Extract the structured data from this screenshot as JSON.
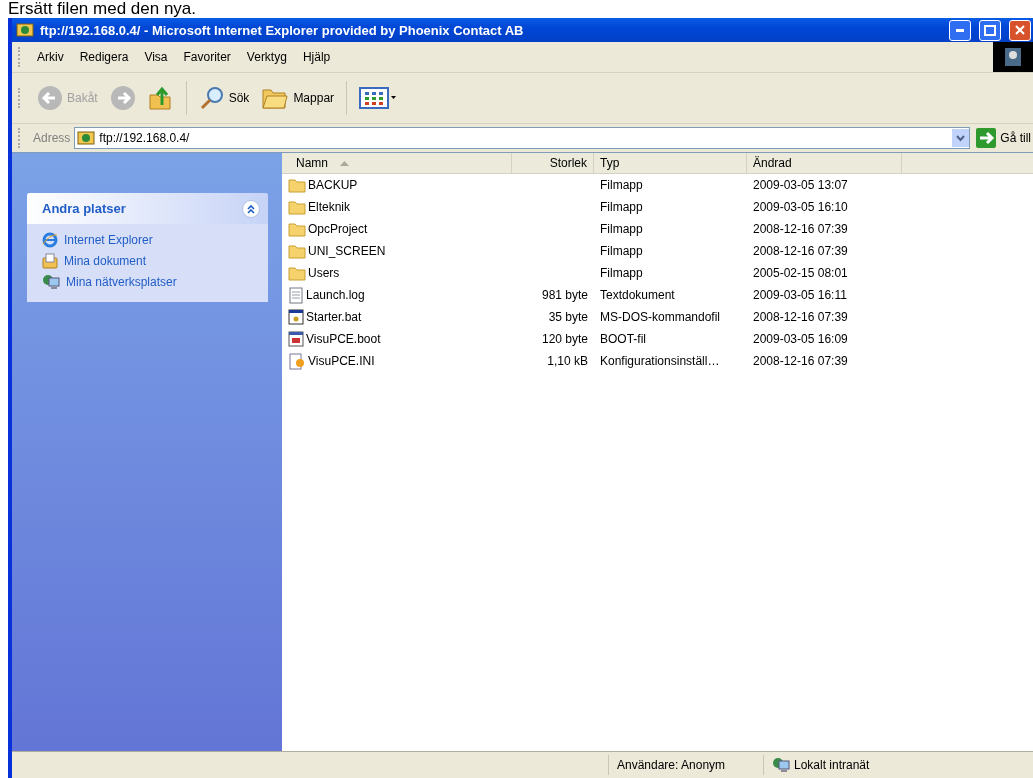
{
  "caption": "Ersätt filen med den nya.",
  "window": {
    "title": "ftp://192.168.0.4/ - Microsoft Internet Explorer provided by Phoenix Contact AB"
  },
  "menu": [
    {
      "label": "Arkiv"
    },
    {
      "label": "Redigera"
    },
    {
      "label": "Visa"
    },
    {
      "label": "Favoriter"
    },
    {
      "label": "Verktyg"
    },
    {
      "label": "Hjälp"
    }
  ],
  "toolbar": [
    {
      "kind": "back",
      "label": "Bakåt",
      "disabled": true
    },
    {
      "kind": "forward",
      "disabled": true
    },
    {
      "kind": "up",
      "disabled": false
    },
    {
      "kind": "search",
      "label": "Sök",
      "disabled": false
    },
    {
      "kind": "folders",
      "label": "Mappar",
      "disabled": false
    },
    {
      "kind": "views",
      "disabled": false
    }
  ],
  "address": {
    "label": "Adress",
    "value": "ftp://192.168.0.4/",
    "go": "Gå till"
  },
  "sidebar": {
    "title": "Andra platser",
    "expanded": true,
    "items": [
      {
        "kind": "ie",
        "label": "Internet Explorer"
      },
      {
        "kind": "docs",
        "label": "Mina dokument"
      },
      {
        "kind": "network",
        "label": "Mina nätverksplatser"
      }
    ]
  },
  "table": {
    "columns": [
      {
        "label": "Namn",
        "sorted": true
      },
      {
        "label": "Storlek",
        "sorted": false
      },
      {
        "label": "Typ",
        "sorted": false
      },
      {
        "label": "Ändrad",
        "sorted": false
      }
    ],
    "rows": [
      {
        "kind": "folder",
        "name": "BACKUP",
        "size": "",
        "type": "Filmapp",
        "modified": "2009-03-05 13:07"
      },
      {
        "kind": "folder",
        "name": "Elteknik",
        "size": "",
        "type": "Filmapp",
        "modified": "2009-03-05 16:10"
      },
      {
        "kind": "folder",
        "name": "OpcProject",
        "size": "",
        "type": "Filmapp",
        "modified": "2008-12-16 07:39"
      },
      {
        "kind": "folder",
        "name": "UNI_SCREEN",
        "size": "",
        "type": "Filmapp",
        "modified": "2008-12-16 07:39"
      },
      {
        "kind": "folder",
        "name": "Users",
        "size": "",
        "type": "Filmapp",
        "modified": "2005-02-15 08:01"
      },
      {
        "kind": "text",
        "name": "Launch.log",
        "size": "981 byte",
        "type": "Textdokument",
        "modified": "2009-03-05 16:11"
      },
      {
        "kind": "bat",
        "name": "Starter.bat",
        "size": "35 byte",
        "type": "MS-DOS-kommandofil",
        "modified": "2008-12-16 07:39"
      },
      {
        "kind": "boot",
        "name": "VisuPCE.boot",
        "size": "120 byte",
        "type": "BOOT-fil",
        "modified": "2009-03-05 16:09"
      },
      {
        "kind": "ini",
        "name": "VisuPCE.INI",
        "size": "1,10 kB",
        "type": "Konfigurationsinställ…",
        "modified": "2008-12-16 07:39"
      }
    ]
  },
  "status_bar": {
    "user": "Användare: Anonym",
    "zone": "Lokalt intranät"
  }
}
